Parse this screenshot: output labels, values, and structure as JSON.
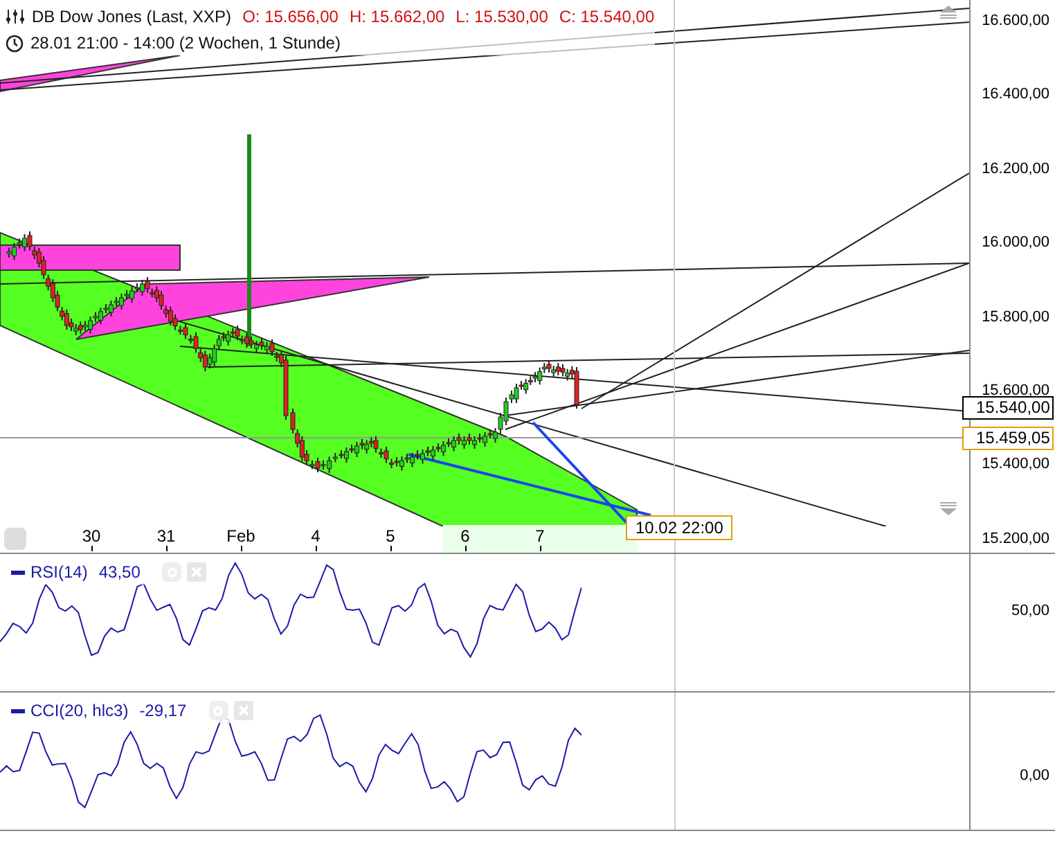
{
  "header": {
    "instrument": "DB Dow Jones (Last, XXP)",
    "ohlc": [
      {
        "label": "O: 15.656,00"
      },
      {
        "label": "H: 15.662,00"
      },
      {
        "label": "L: 15.530,00"
      },
      {
        "label": "C: 15.540,00"
      }
    ],
    "period": "28.01 21:00 - 14:00 (2 Wochen, 1 Stunde)"
  },
  "price_axis": {
    "ticks": [
      "16.600,00",
      "16.400,00",
      "16.200,00",
      "16.000,00",
      "15.800,00",
      "15.600,00",
      "15.400,00",
      "15.200,00"
    ],
    "last_price": "15.540,00",
    "crosshair_price": "15.459,05"
  },
  "time_axis": {
    "ticks": [
      "30",
      "31",
      "Feb",
      "4",
      "5",
      "6",
      "7"
    ],
    "crosshair_time": "10.02 22:00"
  },
  "indicators": [
    {
      "name": "RSI(14)",
      "value": "43,50",
      "axis_tick": "50,00"
    },
    {
      "name": "CCI(20, hlc3)",
      "value": "-29,17",
      "axis_tick": "0,00"
    }
  ]
}
